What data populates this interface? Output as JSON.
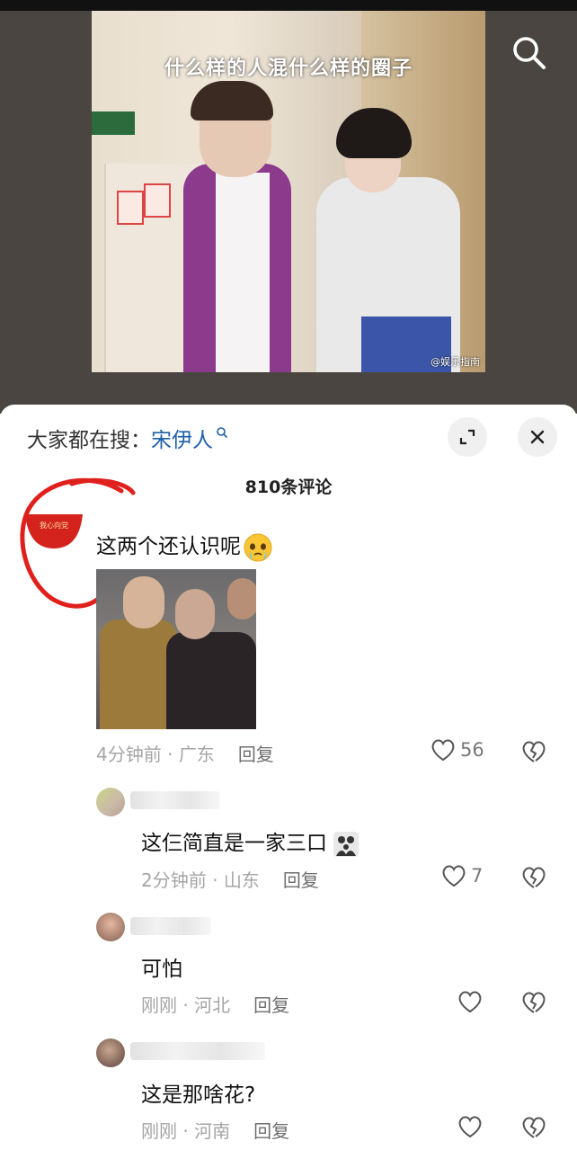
{
  "video": {
    "caption": "什么样的人混什么样的圈子",
    "watermark": "@娱乐指南"
  },
  "panel": {
    "search_hint_prefix": "大家都在搜：",
    "search_hint_term": "宋伊人",
    "comment_count": "810条评论"
  },
  "comments": [
    {
      "avatar_text": "我心向党",
      "text": "这两个还认识呢",
      "time": "4分钟前",
      "location": "广东",
      "reply_label": "回复",
      "likes": "56"
    },
    {
      "text": "这仨简直是一家三口",
      "time": "2分钟前",
      "location": "山东",
      "reply_label": "回复",
      "likes": "7"
    },
    {
      "text": "可怕",
      "time": "刚刚",
      "location": "河北",
      "reply_label": "回复",
      "likes": ""
    },
    {
      "text": "这是那啥花?",
      "time": "刚刚",
      "location": "河南",
      "reply_label": "回复",
      "likes": ""
    }
  ],
  "meta_separator": " · ",
  "colors": {
    "accent_link": "#1d5fa8",
    "annotation_red": "#e0201c",
    "meta_gray": "#a5a5a5"
  }
}
